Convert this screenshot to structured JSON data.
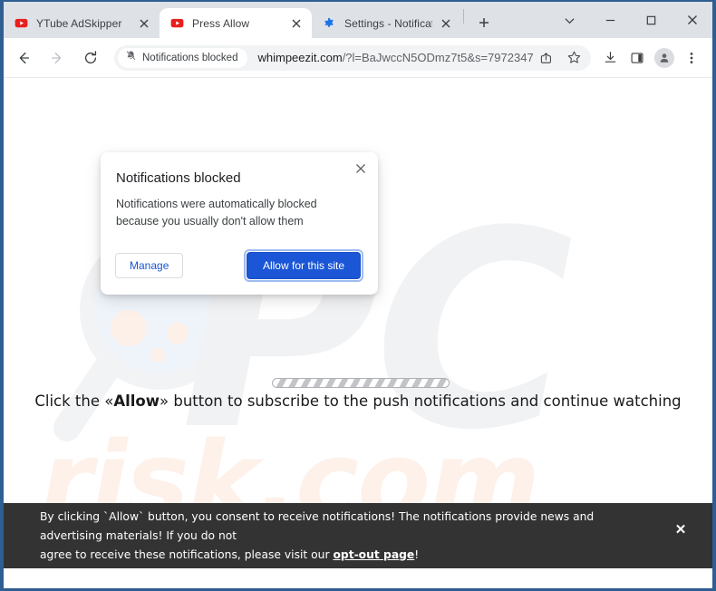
{
  "window": {
    "controls": [
      {
        "name": "tab-search",
        "icon": "chevron-down-icon",
        "glyph": "⌄"
      },
      {
        "name": "minimize",
        "icon": "minimize-icon",
        "glyph": "–"
      },
      {
        "name": "maximize",
        "icon": "maximize-icon",
        "glyph": "□"
      },
      {
        "name": "close",
        "icon": "close-icon",
        "glyph": "✕"
      }
    ]
  },
  "tabs": [
    {
      "title": "YTube AdSkipper",
      "favicon": "youtube-icon",
      "active": false,
      "close_label": "✕"
    },
    {
      "title": "Press Allow",
      "favicon": "youtube-icon",
      "active": true,
      "close_label": "✕"
    },
    {
      "title": "Settings - Notificatio",
      "favicon": "settings-gear-icon",
      "active": false,
      "close_label": "✕"
    }
  ],
  "newtab": {
    "label": "+",
    "tooltip": "New Tab"
  },
  "toolbar": {
    "back": "←",
    "forward": "→",
    "reload": "↻",
    "blocked_chip": "Notifications blocked",
    "url_host": "whimpeezit.com",
    "url_rest": "/?l=BaJwccN5ODmz7t5&s=7972347…",
    "url_full": "whimpeezit.com/?l=BaJwccN5ODmz7t5&s=7972347…",
    "icons": [
      {
        "name": "share-icon"
      },
      {
        "name": "bookmark-star-icon"
      },
      {
        "name": "downloads-icon"
      },
      {
        "name": "side-panel-icon"
      },
      {
        "name": "profile-avatar"
      },
      {
        "name": "browser-menu-icon"
      }
    ]
  },
  "bubble": {
    "title": "Notifications blocked",
    "body": "Notifications were automatically blocked because you usually don't allow them",
    "manage_label": "Manage",
    "allow_label": "Allow for this site",
    "close_label": "✕"
  },
  "page": {
    "watermark_pc": "PC",
    "watermark_risk": "risk.com",
    "cta_prefix": "Click the «Allow»",
    "cta_bold": "Allow",
    "cta_before": "Click the «",
    "cta_after": "» button to subscribe to the push notifications and continue watching",
    "progress_label": "loading-progress"
  },
  "banner": {
    "line1": "By clicking `Allow` button, you consent to receive notifications! The notifications provide news and advertising materials! If you do not",
    "line2_before": "agree to receive these notifications, please visit our ",
    "link": "opt-out page",
    "line2_after": "!",
    "close_label": "✕"
  },
  "colors": {
    "tabstrip_bg": "#dee1e6",
    "accent_blue": "#1a56d6",
    "window_border": "#2f5e92",
    "banner_bg": "#333333",
    "youtube_red": "#e8201f",
    "gear_blue": "#1a73e8"
  }
}
